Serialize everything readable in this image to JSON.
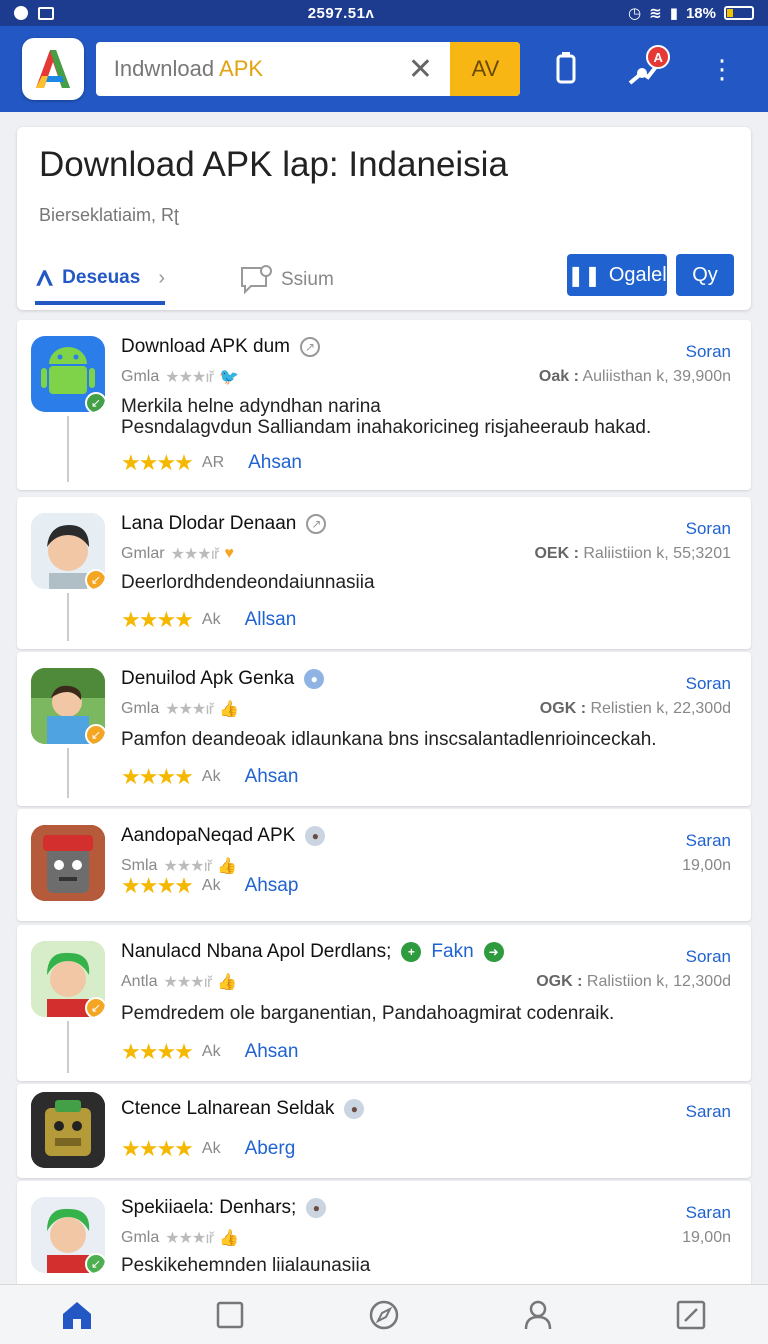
{
  "status": {
    "time": "2597.51ᴧ",
    "battery": "18%"
  },
  "appbar": {
    "search_value_prefix": "Indwnload",
    "search_value_highlight": "APK",
    "go_label": "AV",
    "badge": "A"
  },
  "header": {
    "title": "Download APK lap: Indaneisia",
    "subtitle": "Bierseklatiaim, Rʈ",
    "tabs": [
      {
        "label": "Deseuas"
      },
      {
        "label": "Ssium"
      }
    ],
    "buttons": [
      {
        "label": "Ogalel"
      },
      {
        "label": "Qy"
      }
    ]
  },
  "items": [
    {
      "title": "Download APK dum",
      "meta": "Gmla",
      "link": "Soran",
      "right_key": "Oak :",
      "right_val": "Auliisthan k, 39,900n",
      "desc": [
        "Merkila helne adyndhan narina",
        "Pesndalagvdun Salliandam inahakoricineg risjaheeraub hakad."
      ],
      "rk": "AR",
      "action": "Ahsan",
      "icon": "android",
      "accent": "#2b7de9"
    },
    {
      "title": "Lana Dlodar Denaan",
      "meta": "Gmlar",
      "link": "Soran",
      "right_key": "OEK :",
      "right_val": "Raliistiion k, 55;3201",
      "desc": [
        "Deerlordhdendeondaiunnasiia"
      ],
      "rk": "Ak",
      "action": "Allsan",
      "icon": "boy",
      "accent": "#f4a623"
    },
    {
      "title": "Denuilod Apk Genka",
      "meta": "Gmla",
      "link": "Soran",
      "right_key": "OGK :",
      "right_val": "Relistien k, 22,300d",
      "desc": [
        "Pamfon deandeoak idlaunkana bns inscsalantadlenrioinceckah."
      ],
      "rk": "Ak",
      "action": "Ahsan",
      "icon": "outdoor",
      "accent": "#f4a623"
    },
    {
      "title": "AandopaNeqad APK",
      "meta": "Smla",
      "link": "Saran",
      "right_key": "",
      "right_val": "19,00n",
      "desc": [],
      "rk": "Ak",
      "action": "Ahsap",
      "icon": "robot",
      "accent": "#e53935"
    },
    {
      "title": "Nanulacd Nbana Apol Derdlans;",
      "title_extra": "Fakn",
      "meta": "Antla",
      "link": "Soran",
      "right_key": "OGK :",
      "right_val": "Ralistiion k, 12,300d",
      "desc": [
        "Pemdredem ole barganentian, Pandahoagmirat codenraik."
      ],
      "rk": "Ak",
      "action": "Ahsan",
      "icon": "greenhair",
      "accent": "#f4a623"
    },
    {
      "title": "Ctence Lalnarean Seldak",
      "meta": "",
      "link": "Saran",
      "right_key": "",
      "right_val": "",
      "desc": [],
      "rk": "Ak",
      "action": "Aberg",
      "icon": "robot2",
      "accent": "#4caf50"
    },
    {
      "title": "Spekiiaela: Denhars;",
      "meta": "Gmla",
      "link": "Saran",
      "right_key": "",
      "right_val": "19,00n",
      "desc": [
        "Peskikehemnden liialaunasiia"
      ],
      "rk": "",
      "action": "",
      "icon": "greenhair",
      "accent": "#4caf50"
    }
  ],
  "colors": {
    "primary": "#2358c4",
    "accent": "#f7b614",
    "link": "#1f62d0",
    "star": "#f5b800"
  },
  "bottom_nav": [
    "home-icon",
    "square-icon",
    "compass-icon",
    "profile-icon",
    "edit-icon"
  ]
}
